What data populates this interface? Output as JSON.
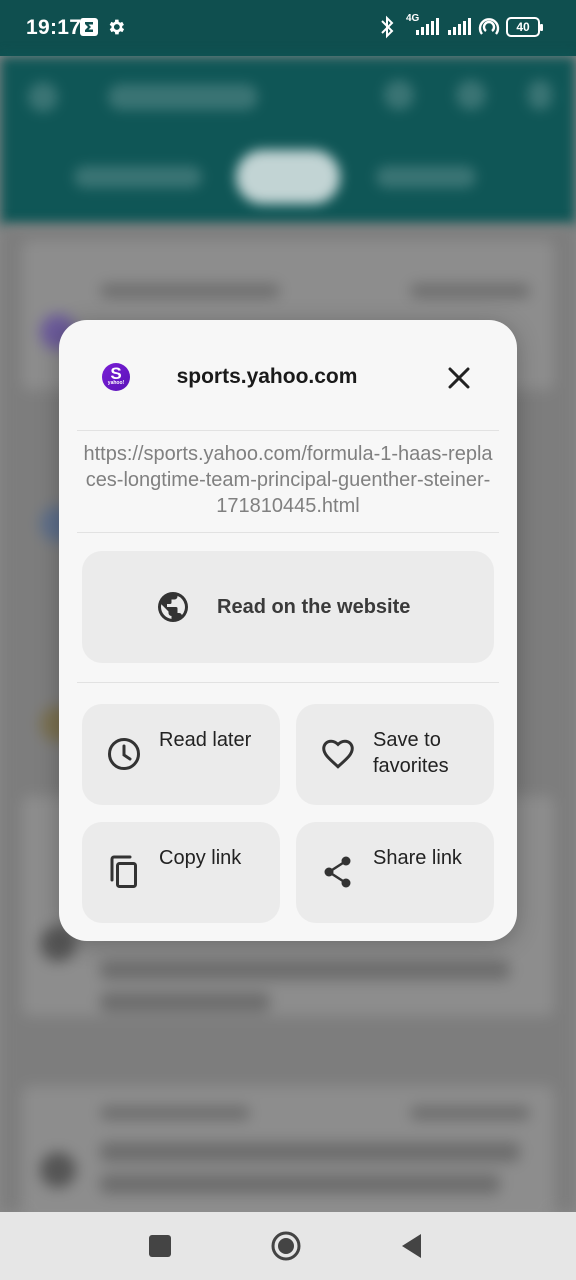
{
  "status_bar": {
    "time": "19:17",
    "network_label": "4G",
    "battery_level": "40",
    "icons": [
      "sigma-app-icon",
      "settings-gear-icon",
      "bluetooth-icon",
      "signal-icon",
      "signal-icon",
      "hotspot-icon",
      "battery-icon"
    ]
  },
  "dialog": {
    "site_icon": "yahoo-sports-logo",
    "site_title": "sports.yahoo.com",
    "url": "https://sports.yahoo.com/formula-1-haas-replaces-longtime-team-principal-guenther-steiner-171810445.html",
    "primary_action": {
      "label": "Read on the website",
      "icon": "globe-icon"
    },
    "actions": [
      {
        "label": "Read later",
        "icon": "clock-icon"
      },
      {
        "label": "Save to favorites",
        "icon": "heart-icon"
      },
      {
        "label": "Copy link",
        "icon": "copy-icon"
      },
      {
        "label": "Share link",
        "icon": "share-icon"
      }
    ]
  },
  "nav_bar": {
    "buttons": [
      "recents-square-icon",
      "home-circle-icon",
      "back-triangle-icon"
    ]
  },
  "colors": {
    "toolbar": "#0f5656",
    "dialog_bg": "#f7f7f7",
    "button_bg": "#ebebeb",
    "site_icon": "#6a18c8"
  }
}
